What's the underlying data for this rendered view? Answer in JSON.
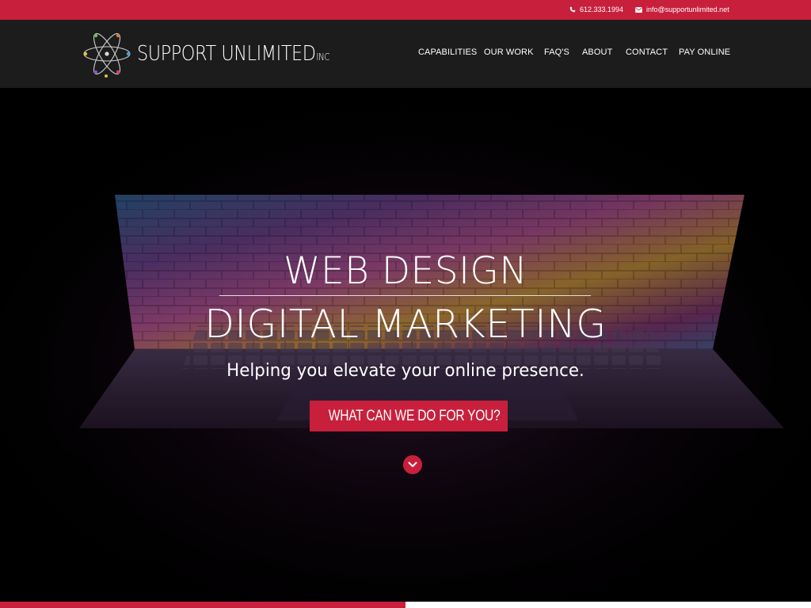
{
  "topbar": {
    "phone": "612.333.1994",
    "email": "info@supportunlimited.net",
    "phone_icon": "phone-icon",
    "email_icon": "envelope-icon"
  },
  "header": {
    "logo_text": "SUPPORT UNLIMITED",
    "logo_suffix": "INC",
    "nav": [
      {
        "label": "CAPABILITIES"
      },
      {
        "label": "OUR WORK"
      },
      {
        "label": "FAQ'S"
      },
      {
        "label": "ABOUT"
      },
      {
        "label": "CONTACT"
      },
      {
        "label": "PAY ONLINE"
      }
    ]
  },
  "hero": {
    "title_line1": "WEB DESIGN",
    "title_line2": "DIGITAL MARKETING",
    "subtitle": "Helping you elevate your online presence.",
    "cta_label": "WHAT CAN WE DO FOR YOU?",
    "scroll_icon": "chevron-down-icon"
  },
  "colors": {
    "accent": "#c8203c",
    "header_bg": "#1c1c1c",
    "hero_bg": "#000000"
  }
}
